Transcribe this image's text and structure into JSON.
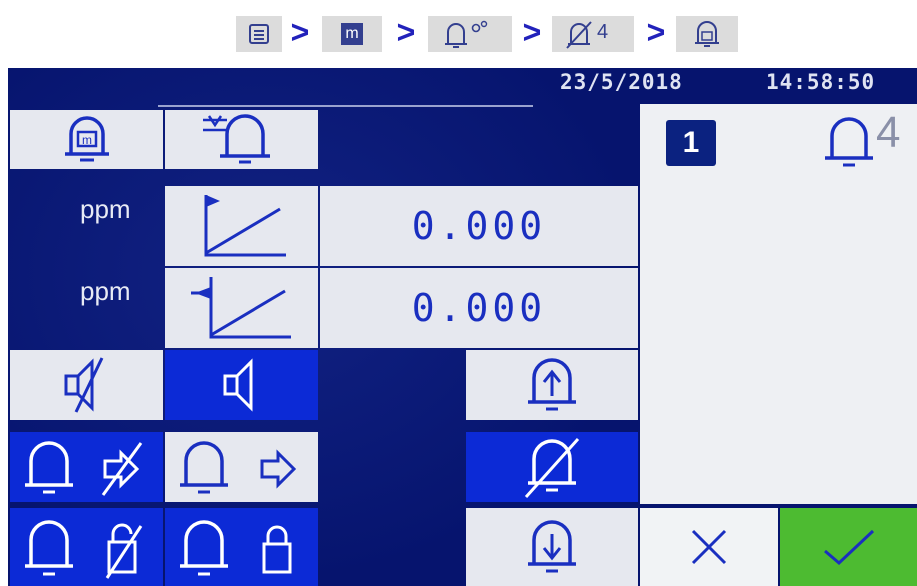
{
  "breadcrumb": {
    "items": [
      {
        "icon": "menu-list-icon",
        "label": ""
      },
      {
        "icon": "m-square-icon",
        "label": "m"
      },
      {
        "icon": "bell-settings-icon",
        "label": ""
      },
      {
        "icon": "bell-muted-4-icon",
        "label": "4"
      },
      {
        "icon": "bell-m-icon",
        "label": ""
      }
    ],
    "separator": ">"
  },
  "status_bar": {
    "date": "23/5/2018",
    "time": "14:58:50"
  },
  "tabs": [
    {
      "icon": "bell-m-icon",
      "active": true
    },
    {
      "icon": "bell-hysteresis-icon",
      "active": false
    }
  ],
  "thresholds": [
    {
      "unit": "ppm",
      "icon": "ramp-high-icon",
      "value": "0.000"
    },
    {
      "unit": "ppm",
      "icon": "ramp-low-icon",
      "value": "0.000"
    }
  ],
  "buzzer": [
    {
      "icon": "speaker-muted-icon",
      "selected": false
    },
    {
      "icon": "speaker-icon",
      "selected": true
    }
  ],
  "latch_modes": [
    {
      "icon": "bell-no-follow-icon",
      "selected": true
    },
    {
      "icon": "bell-follow-icon",
      "selected": false
    },
    {
      "icon": "bell-unlatched-icon",
      "selected": true
    },
    {
      "icon": "bell-latched-icon",
      "selected": false
    }
  ],
  "alarm_direction": [
    {
      "icon": "alarm-rising-icon",
      "selected": false
    },
    {
      "icon": "alarm-disabled-icon",
      "selected": true
    },
    {
      "icon": "alarm-falling-icon",
      "selected": false
    }
  ],
  "channel": {
    "number": "1",
    "alarm_level": "4"
  },
  "actions": {
    "cancel": "✕",
    "ok": "✓"
  },
  "colors": {
    "screen_bg": "#06146e",
    "selected_bg": "#0c2ad6",
    "unselected_bg": "#e6e8ef",
    "icon_blue": "#1a2fc0",
    "ok_green": "#4dbb31"
  }
}
